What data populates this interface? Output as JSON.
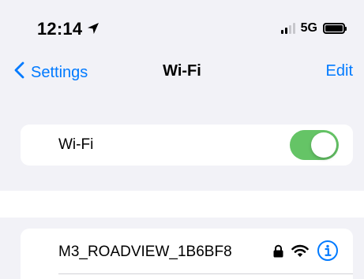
{
  "status_bar": {
    "time": "12:14",
    "location_icon": "location-arrow-icon",
    "signal_icon": "cellular-signal-icon",
    "network": "5G",
    "battery_icon": "battery-icon"
  },
  "nav": {
    "back_label": "Settings",
    "back_icon": "chevron-left-icon",
    "title": "Wi-Fi",
    "edit_label": "Edit"
  },
  "wifi_toggle": {
    "label": "Wi-Fi",
    "enabled": true
  },
  "networks": [
    {
      "name": "M3_ROADVIEW_1B6BF8",
      "icons": [
        "lock-icon",
        "wifi-signal-icon",
        "info-icon"
      ]
    }
  ],
  "colors": {
    "accent": "#007aff",
    "toggle_on": "#65c466",
    "grouped_background": "#f2f2f7",
    "card_background": "#ffffff"
  }
}
